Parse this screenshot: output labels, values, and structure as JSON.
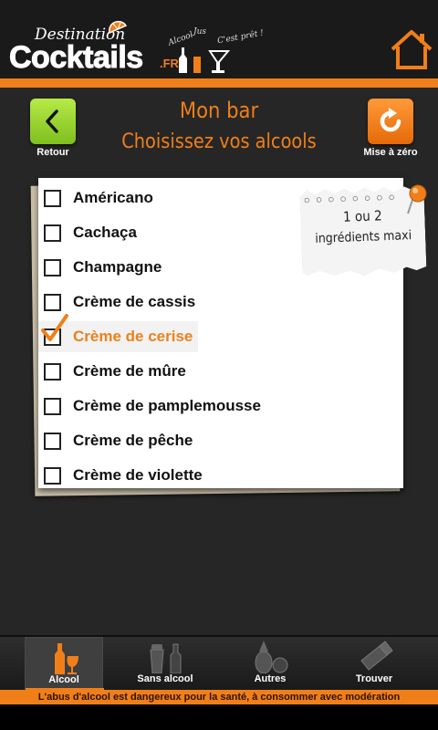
{
  "header": {
    "logo_small": "Destination",
    "logo_big": "Cocktails",
    "logo_suffix": ".FR",
    "tagline_1": "Alcool",
    "tagline_2": "Jus",
    "tagline_3": "C'est prêt !"
  },
  "controls": {
    "back_label": "Retour",
    "reset_label": "Mise à zéro"
  },
  "page": {
    "title": "Mon bar",
    "subtitle": "Choisissez vos alcools"
  },
  "note": {
    "line1": "1 ou 2",
    "line2": "ingrédients maxi"
  },
  "items": [
    {
      "label": "Américano",
      "checked": false
    },
    {
      "label": "Cachaça",
      "checked": false
    },
    {
      "label": "Champagne",
      "checked": false
    },
    {
      "label": "Crème de cassis",
      "checked": false
    },
    {
      "label": "Crème de cerise",
      "checked": true
    },
    {
      "label": "Crème de mûre",
      "checked": false
    },
    {
      "label": "Crème de pamplemousse",
      "checked": false
    },
    {
      "label": "Crème de pêche",
      "checked": false
    },
    {
      "label": "Crème de violette",
      "checked": false
    }
  ],
  "nav": [
    {
      "label": "Alcool",
      "icon": "bottle-glass-icon",
      "active": true
    },
    {
      "label": "Sans alcool",
      "icon": "shaker-bottle-icon",
      "active": false
    },
    {
      "label": "Autres",
      "icon": "pineapple-fruit-icon",
      "active": false
    },
    {
      "label": "Trouver",
      "icon": "shaker-icon",
      "active": false
    }
  ],
  "footer": {
    "warning": "L'abus d'alcool est dangereux pour la santé, à consommer avec modération"
  },
  "colors": {
    "accent": "#f07f1a",
    "back_button": "#8fcf2a",
    "background": "#262626"
  }
}
